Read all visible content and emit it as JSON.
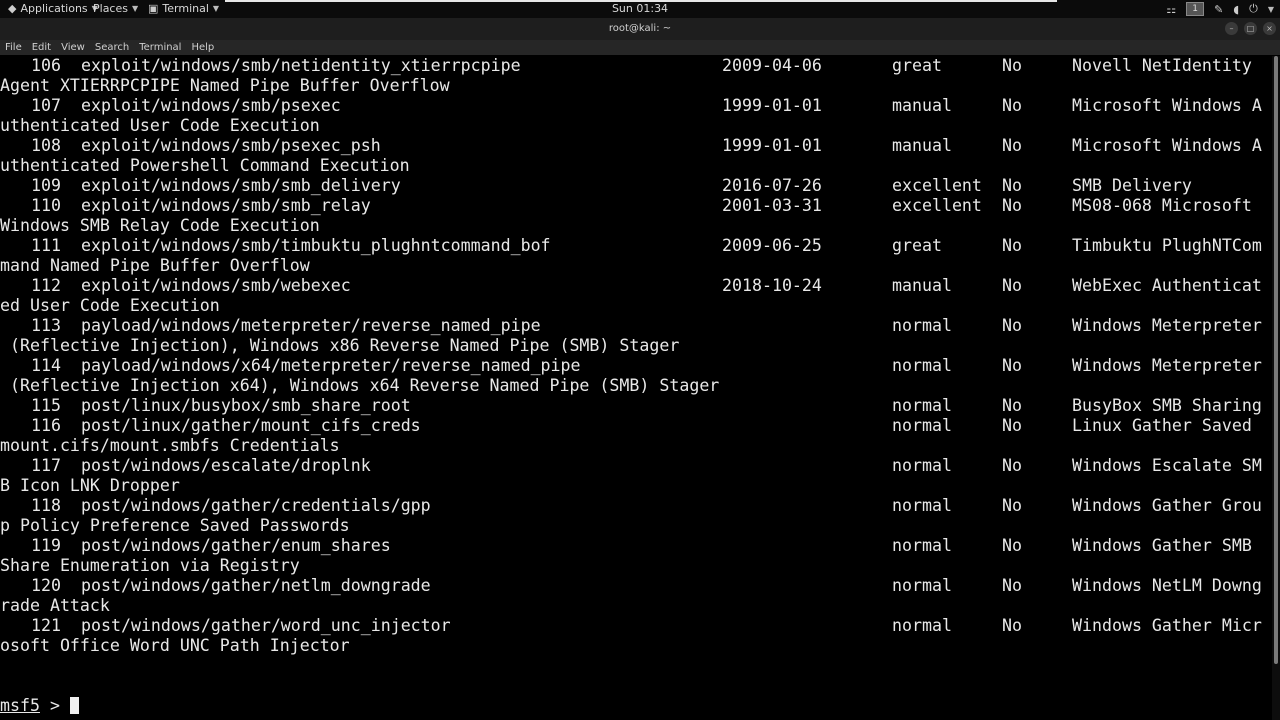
{
  "topbar": {
    "applications": "Applications",
    "places": "Places",
    "terminal_menu": "Terminal",
    "clock": "Sun 01:34",
    "workspace": "1"
  },
  "window": {
    "title": "root@kali: ~"
  },
  "menubar": [
    "File",
    "Edit",
    "View",
    "Search",
    "Terminal",
    "Help"
  ],
  "rows": [
    {
      "num": "106",
      "name": "exploit/windows/smb/netidentity_xtierrpcpipe",
      "date": "2009-04-06",
      "rank": "great",
      "check": "No",
      "desc": "Novell NetIdentity",
      "cont": "Agent XTIERRPCPIPE Named Pipe Buffer Overflow"
    },
    {
      "num": "107",
      "name": "exploit/windows/smb/psexec",
      "date": "1999-01-01",
      "rank": "manual",
      "check": "No",
      "desc": "Microsoft Windows A",
      "cont": "uthenticated User Code Execution"
    },
    {
      "num": "108",
      "name": "exploit/windows/smb/psexec_psh",
      "date": "1999-01-01",
      "rank": "manual",
      "check": "No",
      "desc": "Microsoft Windows A",
      "cont": "uthenticated Powershell Command Execution"
    },
    {
      "num": "109",
      "name": "exploit/windows/smb/smb_delivery",
      "date": "2016-07-26",
      "rank": "excellent",
      "check": "No",
      "desc": "SMB Delivery",
      "cont": ""
    },
    {
      "num": "110",
      "name": "exploit/windows/smb/smb_relay",
      "date": "2001-03-31",
      "rank": "excellent",
      "check": "No",
      "desc": "MS08-068 Microsoft",
      "cont": "Windows SMB Relay Code Execution"
    },
    {
      "num": "111",
      "name": "exploit/windows/smb/timbuktu_plughntcommand_bof",
      "date": "2009-06-25",
      "rank": "great",
      "check": "No",
      "desc": "Timbuktu PlughNTCom",
      "cont": "mand Named Pipe Buffer Overflow"
    },
    {
      "num": "112",
      "name": "exploit/windows/smb/webexec",
      "date": "2018-10-24",
      "rank": "manual",
      "check": "No",
      "desc": "WebExec Authenticat",
      "cont": "ed User Code Execution"
    },
    {
      "num": "113",
      "name": "payload/windows/meterpreter/reverse_named_pipe",
      "date": "",
      "rank": "normal",
      "check": "No",
      "desc": "Windows Meterpreter",
      "cont": " (Reflective Injection), Windows x86 Reverse Named Pipe (SMB) Stager"
    },
    {
      "num": "114",
      "name": "payload/windows/x64/meterpreter/reverse_named_pipe",
      "date": "",
      "rank": "normal",
      "check": "No",
      "desc": "Windows Meterpreter",
      "cont": " (Reflective Injection x64), Windows x64 Reverse Named Pipe (SMB) Stager"
    },
    {
      "num": "115",
      "name": "post/linux/busybox/smb_share_root",
      "date": "",
      "rank": "normal",
      "check": "No",
      "desc": "BusyBox SMB Sharing",
      "cont": ""
    },
    {
      "num": "116",
      "name": "post/linux/gather/mount_cifs_creds",
      "date": "",
      "rank": "normal",
      "check": "No",
      "desc": "Linux Gather Saved",
      "cont": "mount.cifs/mount.smbfs Credentials"
    },
    {
      "num": "117",
      "name": "post/windows/escalate/droplnk",
      "date": "",
      "rank": "normal",
      "check": "No",
      "desc": "Windows Escalate SM",
      "cont": "B Icon LNK Dropper"
    },
    {
      "num": "118",
      "name": "post/windows/gather/credentials/gpp",
      "date": "",
      "rank": "normal",
      "check": "No",
      "desc": "Windows Gather Grou",
      "cont": "p Policy Preference Saved Passwords"
    },
    {
      "num": "119",
      "name": "post/windows/gather/enum_shares",
      "date": "",
      "rank": "normal",
      "check": "No",
      "desc": "Windows Gather SMB",
      "cont": "Share Enumeration via Registry"
    },
    {
      "num": "120",
      "name": "post/windows/gather/netlm_downgrade",
      "date": "",
      "rank": "normal",
      "check": "No",
      "desc": "Windows NetLM Downg",
      "cont": "rade Attack"
    },
    {
      "num": "121",
      "name": "post/windows/gather/word_unc_injector",
      "date": "",
      "rank": "normal",
      "check": "No",
      "desc": "Windows Gather Micr",
      "cont": "osoft Office Word UNC Path Injector"
    }
  ],
  "prompt": {
    "ps": "msf5",
    "sep": " > "
  }
}
